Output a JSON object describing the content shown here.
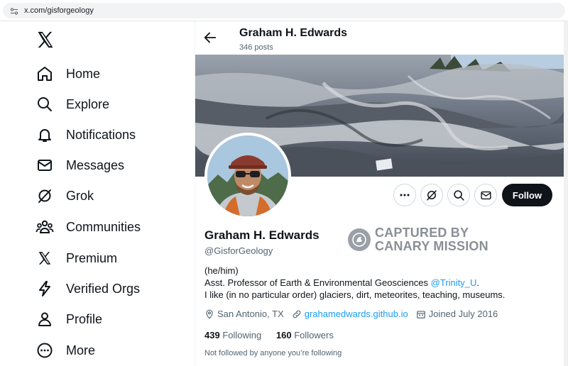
{
  "browser": {
    "url": "x.com/gisforgeology"
  },
  "nav": {
    "items": [
      {
        "label": "Home",
        "icon": "home-icon"
      },
      {
        "label": "Explore",
        "icon": "search-icon"
      },
      {
        "label": "Notifications",
        "icon": "bell-icon"
      },
      {
        "label": "Messages",
        "icon": "envelope-icon"
      },
      {
        "label": "Grok",
        "icon": "grok-icon"
      },
      {
        "label": "Communities",
        "icon": "communities-icon"
      },
      {
        "label": "Premium",
        "icon": "x-logo-icon"
      },
      {
        "label": "Verified Orgs",
        "icon": "lightning-icon"
      },
      {
        "label": "Profile",
        "icon": "person-icon"
      },
      {
        "label": "More",
        "icon": "more-circle-icon"
      }
    ]
  },
  "header": {
    "name": "Graham H. Edwards",
    "posts": "346 posts"
  },
  "profile": {
    "name": "Graham H. Edwards",
    "handle": "@GisforGeology",
    "bio_line1": "(he/him)",
    "bio_line2_prefix": "Asst. Professor of Earth & Environmental Geosciences ",
    "bio_line2_mention": "@Trinity_U",
    "bio_line2_suffix": ".",
    "bio_line3": "I like (in no particular order) glaciers, dirt, meteorites, teaching, museums.",
    "location": "San Antonio, TX",
    "website": "grahamedwards.github.io",
    "joined": "Joined July 2016",
    "following_count": "439",
    "following_label": "Following",
    "followers_count": "160",
    "followers_label": "Followers",
    "not_followed": "Not followed by anyone you’re following"
  },
  "actions": {
    "follow_label": "Follow"
  },
  "watermark": {
    "line1": "CAPTURED BY",
    "line2": "CANARY MISSION"
  },
  "colors": {
    "accent": "#1d9bf0",
    "text": "#0f1419",
    "muted": "#536471",
    "follow_bg": "#0f1419"
  }
}
